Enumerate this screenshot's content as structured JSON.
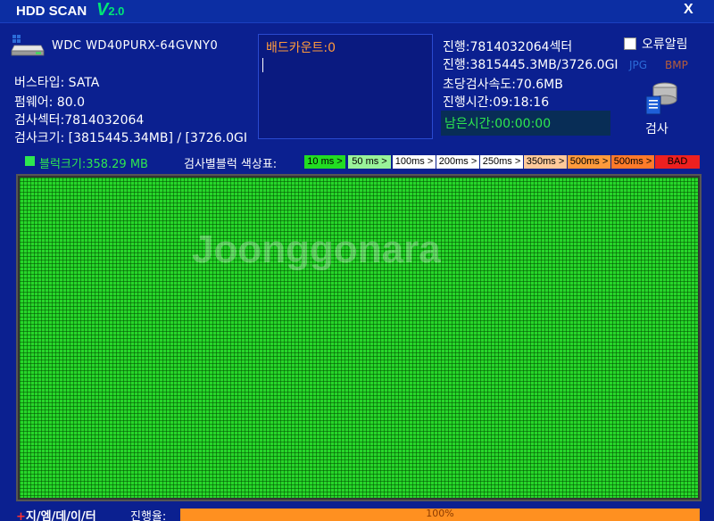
{
  "window": {
    "title": "HDD SCAN",
    "version_prefix": "V",
    "version": "2.0",
    "close_label": "X"
  },
  "drive": {
    "model": "WDC WD40PURX-64GVNY0",
    "bus_type": "버스타입: SATA",
    "firmware": "펌웨어: 80.0",
    "scan_sectors": "검사섹터:7814032064",
    "scan_size": "검사크기: [3815445.34MB] / [3726.0GI"
  },
  "bad_count": {
    "label": "배드카운트:0"
  },
  "progress_info": {
    "sectors": "진행:7814032064섹터",
    "amount": "진행:3815445.3MB/3726.0GI",
    "speed": "초당검사속도:70.6MB",
    "elapsed": "진행시간:09:18:16",
    "remaining": "남은시간:00:00:00"
  },
  "options": {
    "error_alarm_label": "오류알림",
    "error_alarm_checked": false,
    "jpg_label": "JPG",
    "bmp_label": "BMP",
    "scan_button_label": "검사",
    "scan_icon": "disk-scan-icon"
  },
  "legend": {
    "block_size": "블럭크기:358.29 MB",
    "title": "검사별블럭 색상표:",
    "items": [
      {
        "label": "10 ms >",
        "color": "#22dd22"
      },
      {
        "label": "50 ms >",
        "color": "#99f399"
      },
      {
        "label": "100ms >",
        "color": "#ffffff"
      },
      {
        "label": "200ms >",
        "color": "#ffffff"
      },
      {
        "label": "250ms >",
        "color": "#ffffff"
      },
      {
        "label": "350ms >",
        "color": "#ffc99a"
      },
      {
        "label": "500ms >",
        "color": "#ff9a3c"
      },
      {
        "label": "500ms >",
        "color": "#ff7a2a"
      },
      {
        "label": "BAD",
        "color": "#ee2020"
      }
    ]
  },
  "watermark": "Joonggonara",
  "footer": {
    "left_plus": "+",
    "left_text": "지/엠/데/이/터",
    "progress_label": "진행율:",
    "progress_value": "100%",
    "progress_fraction": 1.0
  },
  "colors": {
    "background": "#0b2090",
    "scanned_block": "#27d62a",
    "progress_bar": "#ff9020"
  }
}
